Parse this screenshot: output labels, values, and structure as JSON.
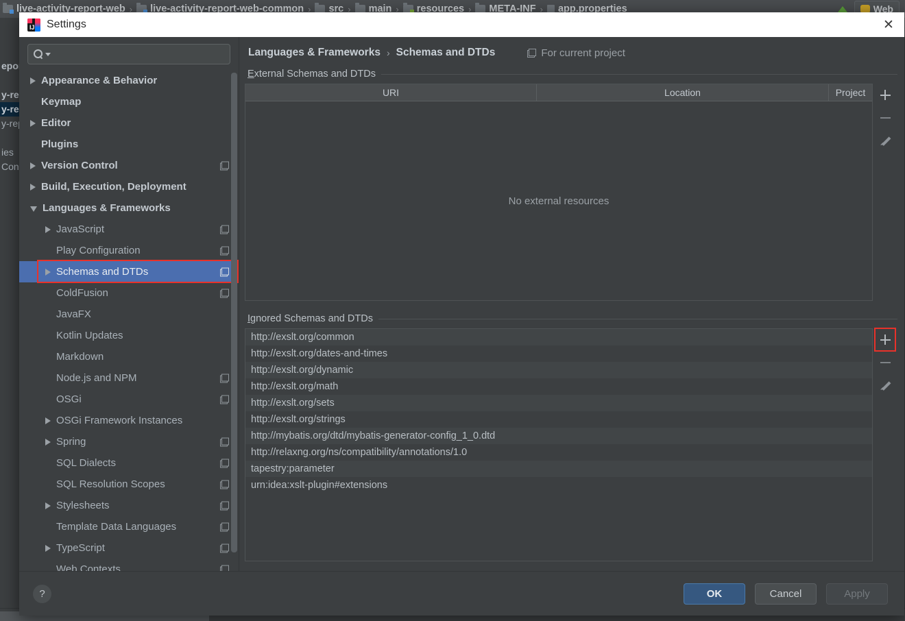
{
  "ide_background": {
    "breadcrumb": [
      {
        "label": "live-activity-report-web",
        "icon": "folder-blue-icon"
      },
      {
        "label": "live-activity-report-web-common",
        "icon": "folder-blue-icon"
      },
      {
        "label": "src",
        "icon": "folder-icon"
      },
      {
        "label": "main",
        "icon": "folder-icon"
      },
      {
        "label": "resources",
        "icon": "folder-green-icon"
      },
      {
        "label": "META-INF",
        "icon": "folder-icon"
      },
      {
        "label": "app.properties",
        "icon": "properties-file-icon"
      }
    ],
    "web_tab_label": "Web",
    "left_tree_rows": [
      {
        "label": "epor",
        "bold": true,
        "selected": false
      },
      {
        "label": "",
        "bold": false,
        "selected": false
      },
      {
        "label": "y-rep",
        "bold": true,
        "selected": false
      },
      {
        "label": "y-rep",
        "bold": true,
        "selected": true
      },
      {
        "label": "y-rep",
        "bold": false,
        "selected": false
      },
      {
        "label": "",
        "bold": false,
        "selected": false
      },
      {
        "label": "ies",
        "bold": false,
        "selected": false
      },
      {
        "label": "Con",
        "bold": false,
        "selected": false
      }
    ]
  },
  "dialog": {
    "title": "Settings",
    "close_label": "✕",
    "search": {
      "value": "",
      "placeholder": ""
    },
    "sidebar": {
      "items": [
        {
          "label": "Appearance & Behavior",
          "level": 0,
          "arrow": "collapsed",
          "copy_icon": false,
          "selected": false
        },
        {
          "label": "Keymap",
          "level": 0,
          "arrow": "none",
          "copy_icon": false,
          "selected": false
        },
        {
          "label": "Editor",
          "level": 0,
          "arrow": "collapsed",
          "copy_icon": false,
          "selected": false
        },
        {
          "label": "Plugins",
          "level": 0,
          "arrow": "none",
          "copy_icon": false,
          "selected": false
        },
        {
          "label": "Version Control",
          "level": 0,
          "arrow": "collapsed",
          "copy_icon": true,
          "selected": false
        },
        {
          "label": "Build, Execution, Deployment",
          "level": 0,
          "arrow": "collapsed",
          "copy_icon": false,
          "selected": false
        },
        {
          "label": "Languages & Frameworks",
          "level": 0,
          "arrow": "expanded",
          "copy_icon": false,
          "selected": false
        },
        {
          "label": "JavaScript",
          "level": 1,
          "arrow": "collapsed",
          "copy_icon": true,
          "selected": false
        },
        {
          "label": "Play Configuration",
          "level": 1,
          "arrow": "none",
          "copy_icon": true,
          "selected": false
        },
        {
          "label": "Schemas and DTDs",
          "level": 1,
          "arrow": "collapsed",
          "copy_icon": true,
          "selected": true
        },
        {
          "label": "ColdFusion",
          "level": 1,
          "arrow": "none",
          "copy_icon": true,
          "selected": false
        },
        {
          "label": "JavaFX",
          "level": 1,
          "arrow": "none",
          "copy_icon": false,
          "selected": false
        },
        {
          "label": "Kotlin Updates",
          "level": 1,
          "arrow": "none",
          "copy_icon": false,
          "selected": false
        },
        {
          "label": "Markdown",
          "level": 1,
          "arrow": "none",
          "copy_icon": false,
          "selected": false
        },
        {
          "label": "Node.js and NPM",
          "level": 1,
          "arrow": "none",
          "copy_icon": true,
          "selected": false
        },
        {
          "label": "OSGi",
          "level": 1,
          "arrow": "none",
          "copy_icon": true,
          "selected": false
        },
        {
          "label": "OSGi Framework Instances",
          "level": 1,
          "arrow": "collapsed",
          "copy_icon": false,
          "selected": false
        },
        {
          "label": "Spring",
          "level": 1,
          "arrow": "collapsed",
          "copy_icon": true,
          "selected": false
        },
        {
          "label": "SQL Dialects",
          "level": 1,
          "arrow": "none",
          "copy_icon": true,
          "selected": false
        },
        {
          "label": "SQL Resolution Scopes",
          "level": 1,
          "arrow": "none",
          "copy_icon": true,
          "selected": false
        },
        {
          "label": "Stylesheets",
          "level": 1,
          "arrow": "collapsed",
          "copy_icon": true,
          "selected": false
        },
        {
          "label": "Template Data Languages",
          "level": 1,
          "arrow": "none",
          "copy_icon": true,
          "selected": false
        },
        {
          "label": "TypeScript",
          "level": 1,
          "arrow": "collapsed",
          "copy_icon": true,
          "selected": false
        },
        {
          "label": "Web Contexts",
          "level": 1,
          "arrow": "none",
          "copy_icon": true,
          "selected": false
        }
      ]
    },
    "main": {
      "breadcrumb": [
        "Languages & Frameworks",
        "Schemas and DTDs"
      ],
      "breadcrumb_separator": "›",
      "for_current_project": "For current project",
      "external_section": {
        "title_mnemonic": "E",
        "title_rest": "xternal Schemas and DTDs",
        "columns": [
          "URI",
          "Location",
          "Project"
        ],
        "rows": [],
        "empty_text": "No external resources",
        "toolbar": [
          {
            "name": "add",
            "glyph": "+",
            "enabled": true,
            "highlighted": false
          },
          {
            "name": "remove",
            "glyph": "−",
            "enabled": false,
            "highlighted": false
          },
          {
            "name": "edit",
            "glyph": "pencil",
            "enabled": false,
            "highlighted": false
          }
        ]
      },
      "ignored_section": {
        "title_mnemonic": "I",
        "title_rest": "gnored Schemas and DTDs",
        "items": [
          "http://exslt.org/common",
          "http://exslt.org/dates-and-times",
          "http://exslt.org/dynamic",
          "http://exslt.org/math",
          "http://exslt.org/sets",
          "http://exslt.org/strings",
          "http://mybatis.org/dtd/mybatis-generator-config_1_0.dtd",
          "http://relaxng.org/ns/compatibility/annotations/1.0",
          "tapestry:parameter",
          "urn:idea:xslt-plugin#extensions"
        ],
        "toolbar": [
          {
            "name": "add",
            "glyph": "+",
            "enabled": true,
            "highlighted": true
          },
          {
            "name": "remove",
            "glyph": "−",
            "enabled": false,
            "highlighted": false
          },
          {
            "name": "edit",
            "glyph": "pencil",
            "enabled": false,
            "highlighted": false
          }
        ]
      }
    },
    "footer": {
      "help_label": "?",
      "ok_label": "OK",
      "cancel_label": "Cancel",
      "apply_label": "Apply",
      "apply_enabled": false
    }
  },
  "colors": {
    "accent_blue": "#4b6eaf",
    "primary_button": "#365880",
    "annotation_red": "#e8322a",
    "panel_bg": "#3c3f41",
    "titlebar_bg": "#ffffff"
  }
}
